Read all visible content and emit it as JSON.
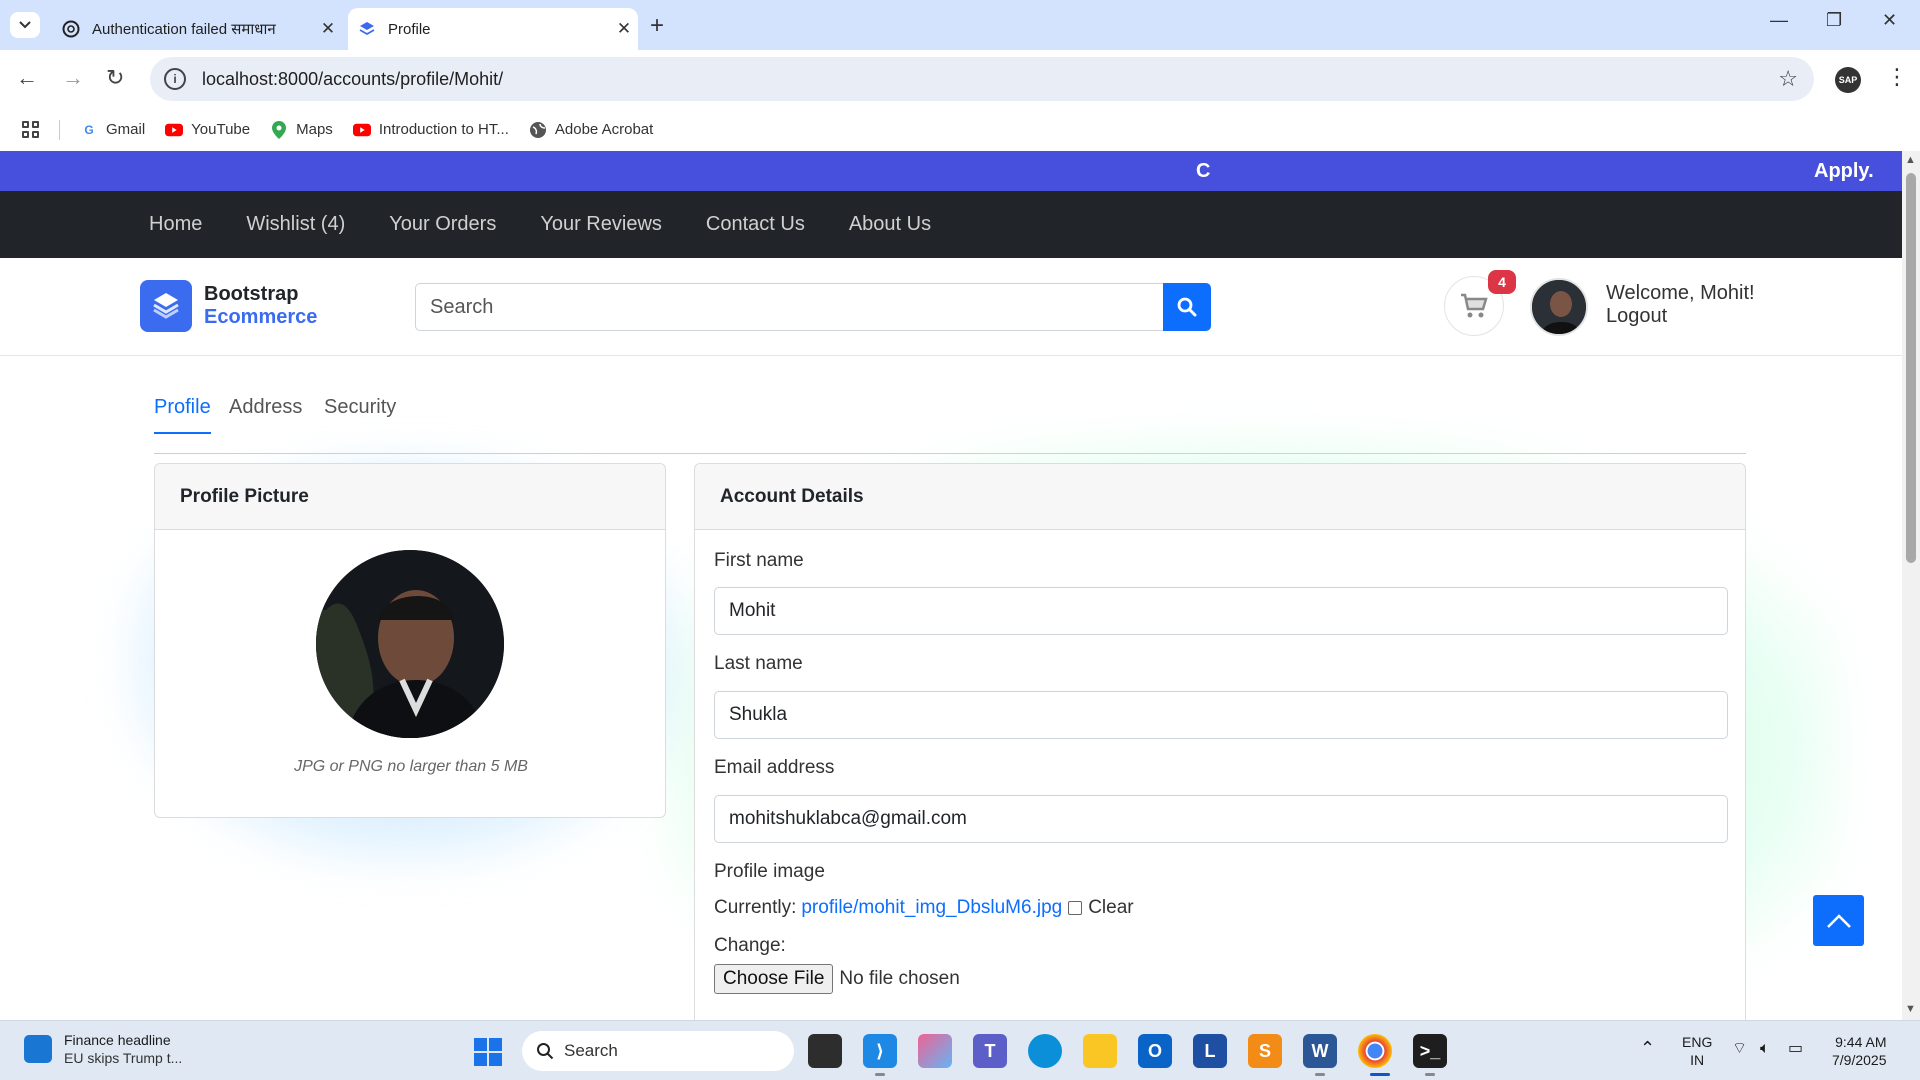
{
  "browser": {
    "tabs": [
      {
        "title": "Authentication failed समाधान",
        "favicon": "chatgpt-icon",
        "active": false
      },
      {
        "title": "Profile",
        "favicon": "layers-icon",
        "active": true
      }
    ],
    "url": "localhost:8000/accounts/profile/Mohit/",
    "bookmarks": [
      {
        "label": "Gmail",
        "icon": "google-icon"
      },
      {
        "label": "YouTube",
        "icon": "youtube-icon"
      },
      {
        "label": "Maps",
        "icon": "maps-icon"
      },
      {
        "label": "Introduction to HT...",
        "icon": "youtube-icon"
      },
      {
        "label": "Adobe Acrobat",
        "icon": "globe-icon"
      }
    ],
    "profile_chip": "SAP"
  },
  "site": {
    "announcement": "Apply.",
    "nav": [
      "Home",
      "Wishlist (4)",
      "Your Orders",
      "Your Reviews",
      "Contact Us",
      "About Us"
    ],
    "logo": {
      "line1": "Bootstrap",
      "line2": "Ecommerce"
    },
    "search_placeholder": "Search",
    "cart_count": "4",
    "welcome": "Welcome, Mohit!",
    "logout": "Logout"
  },
  "profile": {
    "tabs": [
      "Profile",
      "Address",
      "Security"
    ],
    "active_tab": "Profile",
    "picture_card": {
      "title": "Profile Picture",
      "hint": "JPG or PNG no larger than 5 MB"
    },
    "account_card": {
      "title": "Account Details",
      "first_name_label": "First name",
      "first_name": "Mohit",
      "last_name_label": "Last name",
      "last_name": "Shukla",
      "email_label": "Email address",
      "email": "mohitshuklabca@gmail.com",
      "image_label": "Profile image",
      "currently_label": "Currently:",
      "current_file": "profile/mohit_img_DbsluM6.jpg",
      "clear_label": "Clear",
      "change_label": "Change:",
      "choose_file": "Choose File",
      "no_file": "No file chosen"
    }
  },
  "taskbar": {
    "news_title": "Finance headline",
    "news_subtitle": "EU skips Trump t...",
    "search": "Search",
    "lang_top": "ENG",
    "lang_bottom": "IN",
    "time": "9:44 AM",
    "date": "7/9/2025"
  },
  "colors": {
    "accent": "#0d6efd",
    "announcement_bg": "#4650dd",
    "nav_bg": "#212529",
    "badge": "#dc3545"
  }
}
